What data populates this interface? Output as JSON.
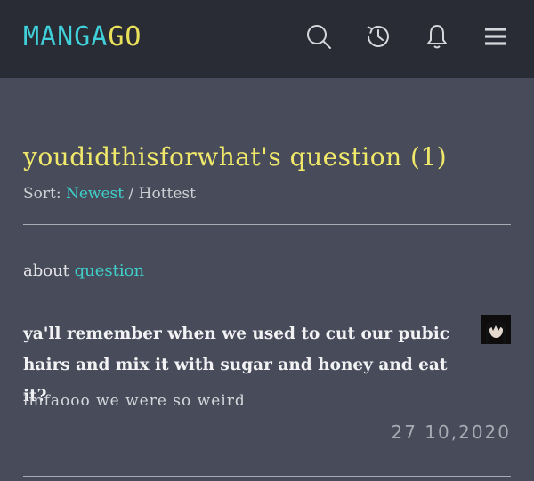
{
  "header": {
    "logo_part1": "MANGA",
    "logo_part2": "GO",
    "icons": [
      "search-icon",
      "history-icon",
      "bell-icon",
      "menu-icon"
    ]
  },
  "page": {
    "title": "youdidthisforwhat's question (1)",
    "sort_label": "Sort:",
    "sort_options": [
      "Newest",
      "Hottest"
    ],
    "sort_separator": "/",
    "sort_selected": "Newest"
  },
  "about": {
    "label": "about",
    "link": "question"
  },
  "post": {
    "title": "ya'll remember when we used to cut our pubic hairs and mix it with sugar and honey and eat it?",
    "body": "lmfaooo we were so weird",
    "date": "27 10,2020"
  },
  "colors": {
    "logo_cyan": "#3fd0d9",
    "logo_yellow": "#e9e15a",
    "title_yellow": "#f0e86a",
    "link_teal": "#3fd0c9",
    "background": "#474b5a",
    "header_bg": "#2a2c35"
  }
}
